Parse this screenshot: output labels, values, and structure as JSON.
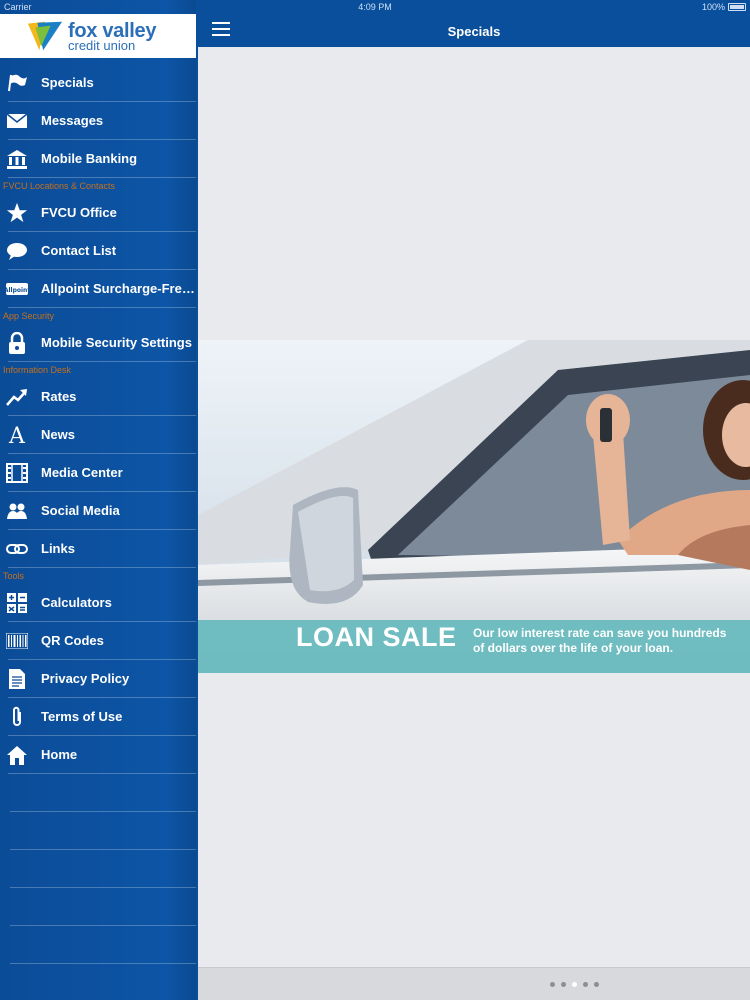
{
  "status_bar": {
    "carrier": "Carrier",
    "time": "4:09 PM",
    "battery": "100%"
  },
  "logo": {
    "line1": "fox valley",
    "line2": "credit union"
  },
  "header": {
    "title": "Specials"
  },
  "sidebar": {
    "groups": [
      {
        "section": "",
        "items": [
          {
            "label": "Specials",
            "icon": "flag-icon"
          },
          {
            "label": "Messages",
            "icon": "envelope-icon"
          },
          {
            "label": "Mobile Banking",
            "icon": "bank-icon"
          }
        ]
      },
      {
        "section": "FVCU Locations & Contacts",
        "items": [
          {
            "label": "FVCU Office",
            "icon": "star-icon"
          },
          {
            "label": "Contact List",
            "icon": "speech-bubble-icon"
          },
          {
            "label": "Allpoint Surcharge-Free ATMs",
            "icon": "allpoint-logo-icon"
          }
        ]
      },
      {
        "section": "App Security",
        "items": [
          {
            "label": "Mobile Security Settings",
            "icon": "lock-icon"
          }
        ]
      },
      {
        "section": "Information Desk",
        "items": [
          {
            "label": "Rates",
            "icon": "trend-up-icon"
          },
          {
            "label": "News",
            "icon": "news-icon"
          },
          {
            "label": "Media Center",
            "icon": "film-icon"
          },
          {
            "label": "Social Media",
            "icon": "people-icon"
          },
          {
            "label": "Links",
            "icon": "link-icon"
          }
        ]
      },
      {
        "section": "Tools",
        "items": [
          {
            "label": "Calculators",
            "icon": "calculator-icon"
          },
          {
            "label": "QR Codes",
            "icon": "barcode-icon"
          },
          {
            "label": "Privacy Policy",
            "icon": "document-icon"
          },
          {
            "label": "Terms of Use",
            "icon": "paperclip-icon"
          },
          {
            "label": "Home",
            "icon": "home-icon"
          }
        ]
      }
    ]
  },
  "banner": {
    "title": "LOAN SALE",
    "description_line1": "Our low interest rate can save you hundreds",
    "description_line2": "of dollars over the life of your loan."
  },
  "pager": {
    "count": 5,
    "active": 3
  },
  "colors": {
    "primary": "#0a4f9c",
    "accent": "#c8701a",
    "banner_strip": "#64b9be"
  }
}
